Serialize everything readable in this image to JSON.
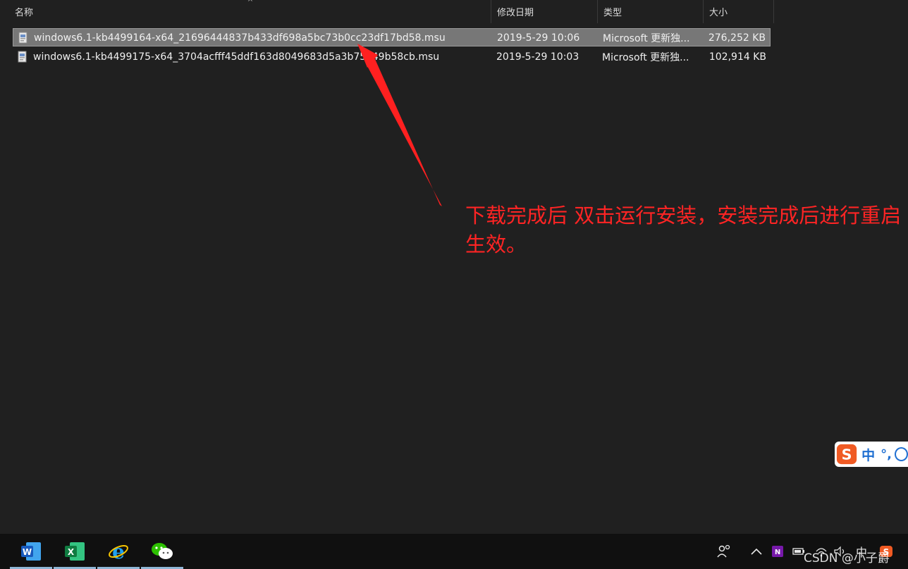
{
  "columns": {
    "name": "名称",
    "modified": "修改日期",
    "type": "类型",
    "size": "大小"
  },
  "files": [
    {
      "name": "windows6.1-kb4499164-x64_21696444837b433df698a5bc73b0cc23df17bd58.msu",
      "modified": "2019-5-29 10:06",
      "type": "Microsoft 更新独...",
      "size": "276,252 KB",
      "selected": true
    },
    {
      "name": "windows6.1-kb4499175-x64_3704acfff45ddf163d8049683d5a3b75e49b58cb.msu",
      "modified": "2019-5-29 10:03",
      "type": "Microsoft 更新独...",
      "size": "102,914 KB",
      "selected": false
    }
  ],
  "annotation": {
    "text": "下载完成后 双击运行安装，安装完成后进行重启生效。",
    "color": "#ff2424"
  },
  "ime": {
    "mode": "中",
    "punct": "°,"
  },
  "taskbar": {
    "apps": [
      {
        "name": "word-icon"
      },
      {
        "name": "excel-icon"
      },
      {
        "name": "ie-icon"
      },
      {
        "name": "wechat-icon"
      }
    ],
    "tray_input": "中"
  },
  "watermark": "CSDN @小子爵",
  "colors": {
    "background": "#202020",
    "selected_row": "#777777",
    "taskbar": "#101010",
    "accent_red": "#ff2424"
  }
}
